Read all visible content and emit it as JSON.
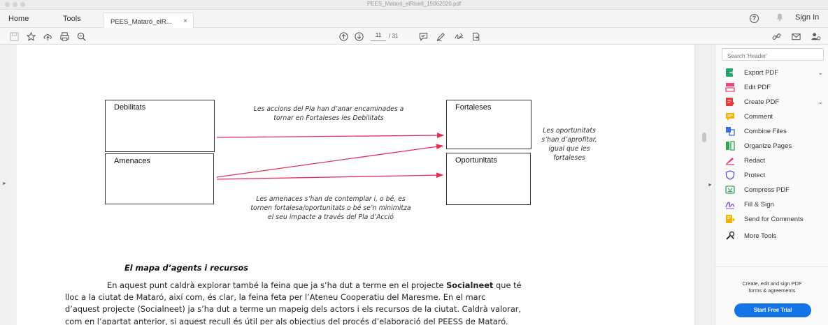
{
  "window": {
    "title": "PEES_Mataró_elRisell_15062020.pdf"
  },
  "tabs": {
    "home": "Home",
    "tools": "Tools",
    "document": "PEES_Mataró_elR...",
    "close": "×",
    "sign_in": "Sign In"
  },
  "toolbar": {
    "current_page": "11",
    "total_pages": "/ 31"
  },
  "diagram": {
    "debilitats": "Debilitats",
    "amenaces": "Amenaces",
    "fortaleses": "Fortaleses",
    "oportunitats": "Oportunitats",
    "note_top_1": "Les accions del Pla han d’anar encaminades a",
    "note_top_2": "tornar en Fortaleses les Debilitats",
    "note_right_1": "Les oportunitats",
    "note_right_2": "s’han d’aprofitar,",
    "note_right_3": "igual que les",
    "note_right_4": "fortaleses",
    "note_bottom_1": "Les amenaces s’han de contemplar i, o bé, es",
    "note_bottom_2": "tornen fortalesa/oportunitats o bé se’n minimitza",
    "note_bottom_3": "el seu impacte a través del Pla d’Acció"
  },
  "document": {
    "heading": "El mapa d’agents i recursos",
    "line1_a": "En aquest punt caldrà explorar també la feina que ja s’ha dut a terme en el projecte ",
    "line1_b": "Socialneet",
    "line1_c": " que té",
    "line2": "lloc a la ciutat de Mataró, així com, és clar, la feina feta per l’Ateneu Cooperatiu del Maresme. En el marc",
    "line3": "d’aquest projecte (Socialneet) ja s’ha dut a terme un mapeig dels actors i els recursos de la ciutat. Caldrà valorar,",
    "line4": "com en l’apartat anterior, si aquest recull és útil per als objectius del procés d’elaboració del PEESS de Mataró."
  },
  "panel": {
    "search_placeholder": "Search 'Header'",
    "tools": [
      {
        "label": "Export PDF",
        "chevron": "⌄"
      },
      {
        "label": "Edit PDF"
      },
      {
        "label": "Create PDF",
        "chevron": "⌄"
      },
      {
        "label": "Comment"
      },
      {
        "label": "Combine Files"
      },
      {
        "label": "Organize Pages"
      },
      {
        "label": "Redact"
      },
      {
        "label": "Protect"
      },
      {
        "label": "Compress PDF"
      },
      {
        "label": "Fill & Sign"
      },
      {
        "label": "Send for Comments"
      },
      {
        "label": "More Tools"
      }
    ],
    "promo_1": "Create, edit and sign PDF",
    "promo_2": "forms & agreements",
    "cta": "Start Free Trial"
  },
  "colors": {
    "accent": "#1473e6",
    "arrow": "#e0305a",
    "export": "#28a36a",
    "edit": "#e84a78",
    "create": "#e83c3c",
    "comment": "#f4b400",
    "combine": "#3b6fe0",
    "organize": "#2ea84f",
    "redact": "#e83c6a",
    "protect": "#5b5fd6",
    "compress": "#3aa35a",
    "fill": "#8a4fd6",
    "send": "#f0b400"
  }
}
